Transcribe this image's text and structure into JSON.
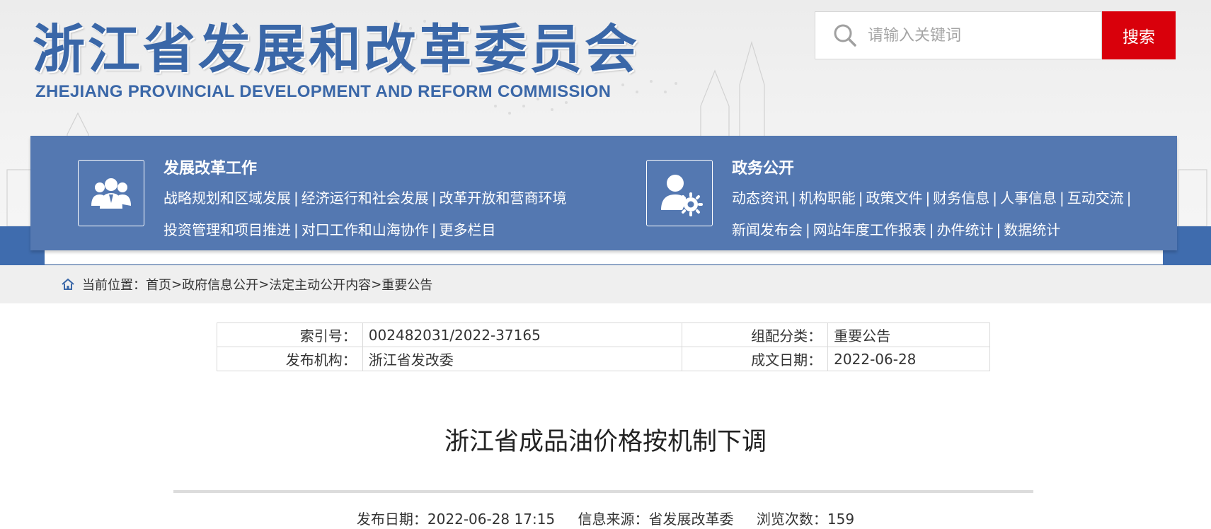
{
  "header": {
    "logo_cn": "浙江省发展和改革委员会",
    "logo_en": "ZHEJIANG PROVINCIAL DEVELOPMENT AND REFORM COMMISSION",
    "search_placeholder": "请输入关键词",
    "search_button": "搜索"
  },
  "nav": {
    "left": {
      "title": "发展改革工作",
      "icon": "people-group-icon",
      "row1": [
        "战略规划和区域发展",
        "经济运行和社会发展",
        "改革开放和营商环境"
      ],
      "row2": [
        "投资管理和项目推进",
        "对口工作和山海协作",
        "更多栏目"
      ]
    },
    "right": {
      "title": "政务公开",
      "icon": "user-gear-icon",
      "row1": [
        "动态资讯",
        "机构职能",
        "政策文件",
        "财务信息",
        "人事信息",
        "互动交流"
      ],
      "row2": [
        "新闻发布会",
        "网站年度工作报表",
        "办件统计",
        "数据统计"
      ]
    },
    "separator": "|"
  },
  "breadcrumb": {
    "label": "当前位置：",
    "items": [
      "首页",
      "政府信息公开",
      "法定主动公开内容",
      "重要公告"
    ],
    "sep": ">"
  },
  "info": {
    "index_label": "索引号：",
    "index_value": "002482031/2022-37165",
    "category_label": "组配分类：",
    "category_value": "重要公告",
    "org_label": "发布机构：",
    "org_value": "浙江省发改委",
    "date_label": "成文日期：",
    "date_value": "2022-06-28"
  },
  "article": {
    "title": "浙江省成品油价格按机制下调",
    "publish_date": "发布日期：2022-06-28 17:15",
    "source": "信息来源：省发展改革委",
    "views": "浏览次数：159"
  },
  "colors": {
    "brand_blue": "#3a67a8",
    "nav_blue": "#5478b1",
    "search_red": "#d9000b"
  }
}
